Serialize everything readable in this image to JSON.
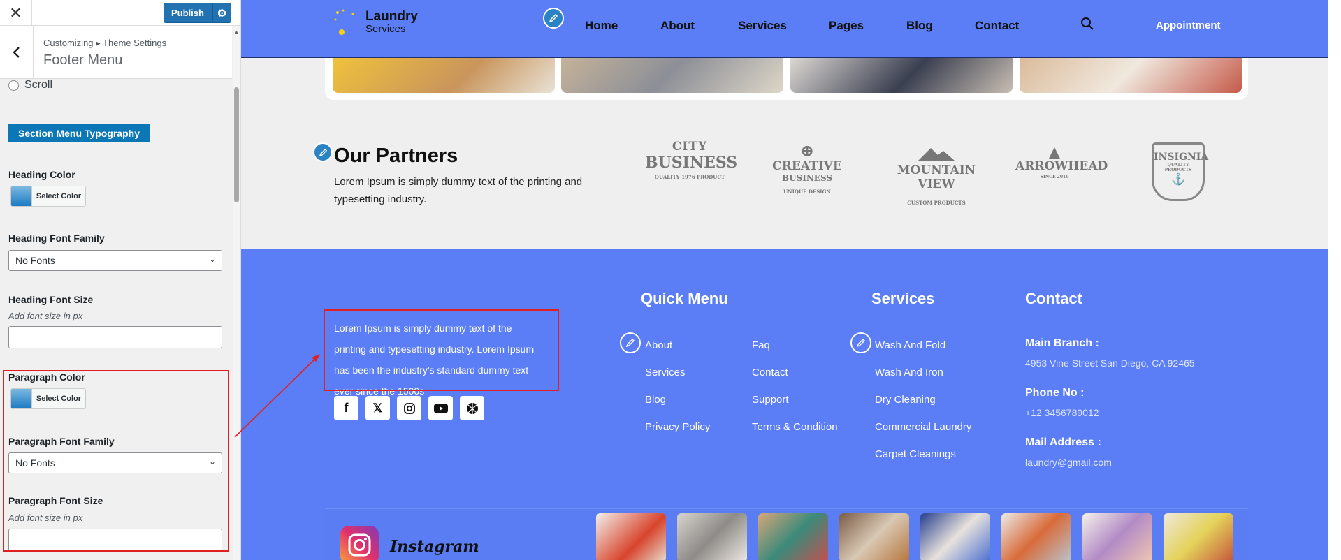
{
  "customizer": {
    "close": "✕",
    "publish_label": "Publish",
    "breadcrumb": "Customizing ▸ Theme Settings",
    "panel_title": "Footer Menu",
    "scroll_option": "Scroll",
    "section_button": "Section Menu Typography",
    "heading_color_label": "Heading Color",
    "select_color": "Select Color",
    "heading_font_family_label": "Heading Font Family",
    "font_option": "No Fonts",
    "heading_font_size_label": "Heading Font Size",
    "font_size_desc": "Add font size in px",
    "paragraph_color_label": "Paragraph Color",
    "paragraph_font_family_label": "Paragraph Font Family",
    "paragraph_font_size_label": "Paragraph Font Size"
  },
  "site": {
    "logo_title": "Laundry",
    "logo_sub": "Services",
    "nav": [
      "Home",
      "About",
      "Services",
      "Pages",
      "Blog",
      "Contact"
    ],
    "appointment": "Appointment",
    "partners_title": "Our Partners",
    "partners_text": "Lorem Ipsum is simply dummy text of the printing and typesetting industry.",
    "partner_logos": [
      {
        "l1": "CITY",
        "l2": "BUSINESS",
        "l3": "QUALITY  1976  PRODUCT"
      },
      {
        "l1": "CREATIVE",
        "l2": "BUSINESS",
        "l3": "UNIQUE DESIGN"
      },
      {
        "l1": "MOUNTAIN VIEW",
        "l2": "",
        "l3": "CUSTOM PRODUCTS"
      },
      {
        "l1": "ARROWHEAD",
        "l2": "",
        "l3": "SINCE 2019"
      },
      {
        "l1": "INSIGNIA",
        "l2": "",
        "l3": "QUALITY PRODUCTS"
      }
    ],
    "footer_text": "Lorem Ipsum is simply dummy text of the printing and typesetting industry. Lorem Ipsum has been the industry's standard dummy text ever since the 1500s",
    "quick_menu_title": "Quick Menu",
    "quick_menu_col1": [
      "About",
      "Services",
      "Blog",
      "Privacy Policy"
    ],
    "quick_menu_col2": [
      "Faq",
      "Contact",
      "Support",
      "Terms & Condition"
    ],
    "services_title": "Services",
    "services": [
      "Wash And Fold",
      "Wash And Iron",
      "Dry Cleaning",
      "Commercial Laundry",
      "Carpet Cleanings"
    ],
    "contact_title": "Contact",
    "main_branch_label": "Main Branch :",
    "main_branch_value": "4953 Vine Street San Diego, CA 92465",
    "phone_label": "Phone No :",
    "phone_value": "+12 3456789012",
    "mail_label": "Mail Address :",
    "mail_value": "laundry@gmail.com",
    "instagram_label": "Instagram"
  },
  "colors": {
    "nav_bg": "#5b7ef6",
    "accent": "#0b77b6",
    "highlight": "#e02020",
    "publish": "#2271b1"
  }
}
